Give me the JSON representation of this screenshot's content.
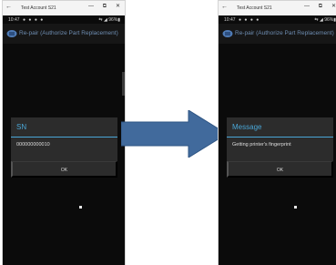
{
  "left": {
    "window_title": "Test Account S21",
    "status_time": "10:47",
    "status_icons": "● ● ● ●",
    "status_right": "⇆ ◢ 96%▮",
    "app_title": "Re-pair (Authorize Part Replacement)",
    "dialog_title": "SN",
    "dialog_message": "000000000010",
    "ok_label": "OK"
  },
  "right": {
    "window_title": "Test Account S21",
    "status_time": "10:47",
    "status_icons": "● ● ● ●",
    "status_right": "⇆ ◢ 96%▮",
    "app_title": "Re-pair (Authorize Part Replacement)",
    "dialog_title": "Message",
    "dialog_message": "Getting printer's fingerprint",
    "ok_label": "OK"
  },
  "window_controls": {
    "back": "←",
    "minimize": "—",
    "maximize": "⧉",
    "close": "✕"
  },
  "colors": {
    "arrow": "#416a9c",
    "accent": "#4aa6d6",
    "app_title": "#6e8db2",
    "dialog_bg": "#2c2c2c"
  },
  "icons": [
    "back-arrow-icon",
    "minimize-icon",
    "maximize-icon",
    "close-icon",
    "app-logo-icon",
    "right-arrow-icon"
  ]
}
